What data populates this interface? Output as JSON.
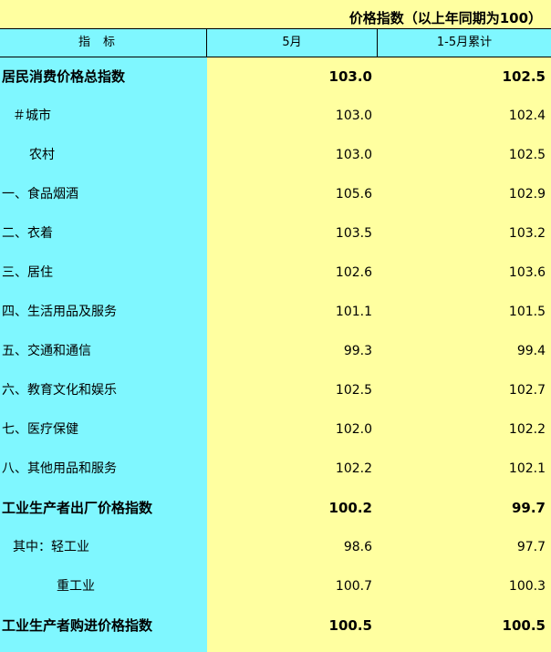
{
  "title": "价格指数（以上年同期为100）",
  "header": {
    "col_indicator": "指标",
    "col_month": "5月",
    "col_cumulative": "1-5月累计"
  },
  "rows": [
    {
      "name": "居民消费价格总指数",
      "month": "103.0",
      "cumulative": "102.5"
    },
    {
      "name": "＃城市",
      "month": "103.0",
      "cumulative": "102.4"
    },
    {
      "name": "农村",
      "month": "103.0",
      "cumulative": "102.5"
    },
    {
      "name": "一、食品烟酒",
      "month": "105.6",
      "cumulative": "102.9"
    },
    {
      "name": "二、衣着",
      "month": "103.5",
      "cumulative": "103.2"
    },
    {
      "name": "三、居住",
      "month": "102.6",
      "cumulative": "103.6"
    },
    {
      "name": "四、生活用品及服务",
      "month": "101.1",
      "cumulative": "101.5"
    },
    {
      "name": "五、交通和通信",
      "month": "99.3",
      "cumulative": "99.4"
    },
    {
      "name": "六、教育文化和娱乐",
      "month": "102.5",
      "cumulative": "102.7"
    },
    {
      "name": "七、医疗保健",
      "month": "102.0",
      "cumulative": "102.2"
    },
    {
      "name": "八、其他用品和服务",
      "month": "102.2",
      "cumulative": "102.1"
    },
    {
      "name": "工业生产者出厂价格指数",
      "month": "100.2",
      "cumulative": "99.7"
    },
    {
      "name": "其中：轻工业",
      "month": "98.6",
      "cumulative": "97.7"
    },
    {
      "name": "重工业",
      "month": "100.7",
      "cumulative": "100.3"
    },
    {
      "name": "工业生产者购进价格指数",
      "month": "100.5",
      "cumulative": "100.5"
    }
  ]
}
